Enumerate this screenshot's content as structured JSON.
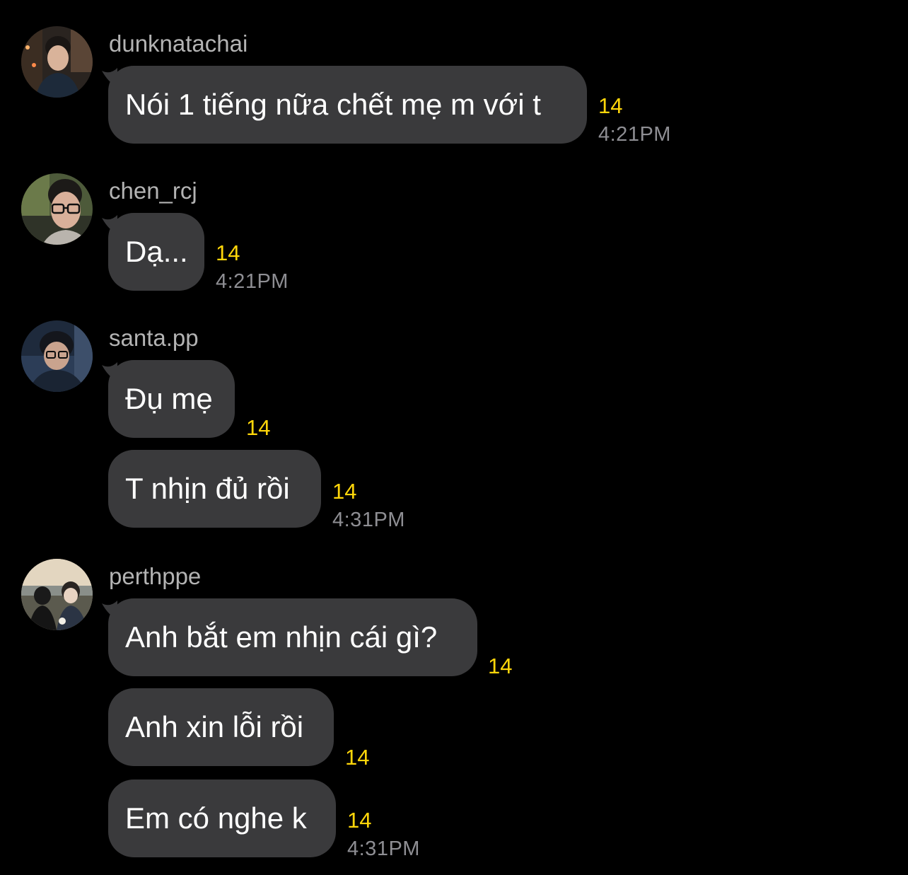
{
  "messages": [
    {
      "username": "dunknatachai",
      "avatar_icon": "user-avatar",
      "bubbles": [
        {
          "text": "Nói 1 tiếng nữa chết mẹ m với t",
          "count": "14",
          "time": "4:21PM"
        }
      ]
    },
    {
      "username": "chen_rcj",
      "avatar_icon": "user-avatar",
      "bubbles": [
        {
          "text": "Dạ...",
          "count": "14",
          "time": "4:21PM"
        }
      ]
    },
    {
      "username": "santa.pp",
      "avatar_icon": "user-avatar",
      "bubbles": [
        {
          "text": "Đụ mẹ",
          "count": "14"
        },
        {
          "text": "T nhịn đủ rồi",
          "count": "14",
          "time": "4:31PM"
        }
      ]
    },
    {
      "username": "perthppe",
      "avatar_icon": "user-avatar",
      "bubbles": [
        {
          "text": "Anh bắt em nhịn cái gì?",
          "count": "14"
        },
        {
          "text": "Anh xin lỗi rồi",
          "count": "14"
        },
        {
          "text": "Em có nghe k",
          "count": "14",
          "time": "4:31PM"
        }
      ]
    }
  ],
  "colors": {
    "background": "#000000",
    "bubble": "#3a3a3c",
    "count_accent": "#ffd60a",
    "timestamp": "#8e8e93",
    "username": "#b3b3b3"
  }
}
